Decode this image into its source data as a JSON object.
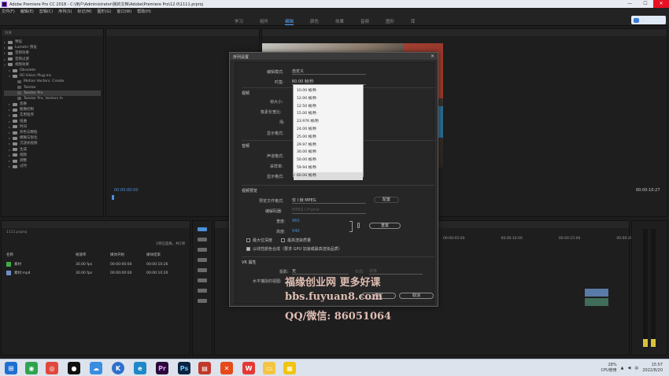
{
  "window": {
    "title": "Adobe Premiere Pro CC 2018 - C:\\用户\\Administrator\\我的文档\\Adobe\\Premiere Pro\\12.0\\1111.prproj",
    "controls": {
      "minimize": "—",
      "maximize": "☐",
      "close": "✕"
    }
  },
  "menu": [
    "文件(F)",
    "编辑(E)",
    "剪辑(C)",
    "序列(S)",
    "标记(M)",
    "图形(G)",
    "窗口(W)",
    "帮助(H)"
  ],
  "workspaces": [
    "学习",
    "组件",
    "编辑",
    "颜色",
    "效果",
    "音频",
    "图形",
    "库"
  ],
  "workspace_active": "编辑",
  "badge_text": "...",
  "effects_panel": {
    "header": "效果",
    "items": [
      {
        "label": "预设",
        "type": "folder"
      },
      {
        "label": "Lumetri 预设",
        "type": "folder"
      },
      {
        "label": "音频效果",
        "type": "folder"
      },
      {
        "label": "音频过渡",
        "type": "folder"
      },
      {
        "label": "视频效果",
        "type": "folder",
        "open": true
      },
      {
        "label": "Obsolete",
        "type": "folder",
        "indent": 1
      },
      {
        "label": "RE:Vision Plug-ins",
        "type": "folder",
        "indent": 1,
        "open": true
      },
      {
        "label": "Motion Vectors: Create",
        "type": "item",
        "indent": 2
      },
      {
        "label": "Twixtor",
        "type": "item",
        "indent": 2
      },
      {
        "label": "Twixtor Pro",
        "type": "item",
        "indent": 2,
        "selected": true
      },
      {
        "label": "Twixtor Pro, Vectors In",
        "type": "item",
        "indent": 2
      },
      {
        "label": "变换",
        "type": "folder",
        "indent": 1
      },
      {
        "label": "图像控制",
        "type": "folder",
        "indent": 1
      },
      {
        "label": "实用程序",
        "type": "folder",
        "indent": 1
      },
      {
        "label": "扭曲",
        "type": "folder",
        "indent": 1
      },
      {
        "label": "时间",
        "type": "folder",
        "indent": 1
      },
      {
        "label": "杂色与颗粒",
        "type": "folder",
        "indent": 1
      },
      {
        "label": "模糊与锐化",
        "type": "folder",
        "indent": 1
      },
      {
        "label": "沉浸式视频",
        "type": "folder",
        "indent": 1
      },
      {
        "label": "生成",
        "type": "folder",
        "indent": 1
      },
      {
        "label": "视频",
        "type": "folder",
        "indent": 1
      },
      {
        "label": "调整",
        "type": "folder",
        "indent": 1
      },
      {
        "label": "过时",
        "type": "folder",
        "indent": 1
      }
    ]
  },
  "source_monitor": {
    "timecode": "00:00:00:00"
  },
  "program_monitor": {
    "timecode": "00:00:10:27"
  },
  "project_panel": {
    "filename": "1111.prproj",
    "count": "1项已选择，共1项",
    "columns": [
      "名称",
      "帧速率",
      "媒体开始",
      "媒体结束"
    ],
    "rows": [
      {
        "name": "素材",
        "fps": "30.00 fps",
        "start": "00:00:00:00",
        "end": "00:00:10:26",
        "color": "#3cb043"
      },
      {
        "name": "素材.mp4",
        "fps": "30.00 fps",
        "start": "00:00:00:00",
        "end": "00:00:10:26",
        "color": "#6d8ec7"
      }
    ]
  },
  "timeline": {
    "ruler": [
      "00:00:05:00",
      "00:00:10:00",
      "00:00:15:00",
      "00:00:20:00"
    ]
  },
  "dialog": {
    "title": "序列设置",
    "close": "×",
    "mode_label": "编辑模式:",
    "mode_value": "自定义",
    "timebase_label": "时基:",
    "timebase_value": "60.00 帧/秒",
    "video_section": "视频",
    "frame_size_label": "帧大小:",
    "pixel_aspect_label": "像素长宽比:",
    "fields_label": "场:",
    "display_format_label": "显示格式:",
    "audio_section": "音频",
    "sample_rate_label": "采样率:",
    "audio_display_label": "显示格式:",
    "audio_channels_label": "声道格式:",
    "preview_section": "视频预览",
    "preview_format_label": "预览文件格式:",
    "preview_format_value": "仅 I 帧 MPEG",
    "configure_label": "配置",
    "codec_label": "编解码器:",
    "codec_value": "MPEG I-Frame",
    "width_label": "宽度:",
    "width_value": "960",
    "height_label": "高度:",
    "height_value": "540",
    "reset_label": "重置",
    "max_depth_label": "最大位深度",
    "max_quality_label": "最高渲染质量",
    "linear_label": "以线性颜色合成（要求 GPU 加速或最高渲染品质）",
    "vr_section": "VR 属性",
    "projection_label": "投影:",
    "projection_value": "无",
    "layout_label": "布局:",
    "layout_value": "单像",
    "hcapture_label": "水平捕捉的视图:",
    "ok_label": "确定",
    "cancel_label": "取消"
  },
  "timebase_options": [
    {
      "label": "10.00  帧/秒"
    },
    {
      "label": "12.00  帧/秒"
    },
    {
      "label": "12.50  帧/秒"
    },
    {
      "label": "15.00  帧/秒"
    },
    {
      "label": "23.976  帧/秒"
    },
    {
      "label": "24.00  帧/秒"
    },
    {
      "label": "25.00  帧/秒"
    },
    {
      "label": "29.97  帧/秒"
    },
    {
      "label": "30.00  帧/秒"
    },
    {
      "label": "50.00  帧/秒"
    },
    {
      "label": "59.94  帧/秒"
    },
    {
      "label": "60.00  帧/秒",
      "checked": true
    }
  ],
  "watermark": {
    "line1": "福缘创业网 更多好课",
    "line2": "bbs.fuyuan8.com",
    "line3": "QQ/微信: 86051064"
  },
  "taskbar": {
    "apps": [
      "start",
      "360",
      "chrome",
      "qq",
      "baidu",
      "k",
      "edge",
      "premiere",
      "photoshop",
      "wps-chart",
      "xmind",
      "wps",
      "folder",
      "notes"
    ],
    "cpu": "28%",
    "cpu_label": "CPU使用",
    "time": "15:57",
    "date": "2022/8/20"
  }
}
